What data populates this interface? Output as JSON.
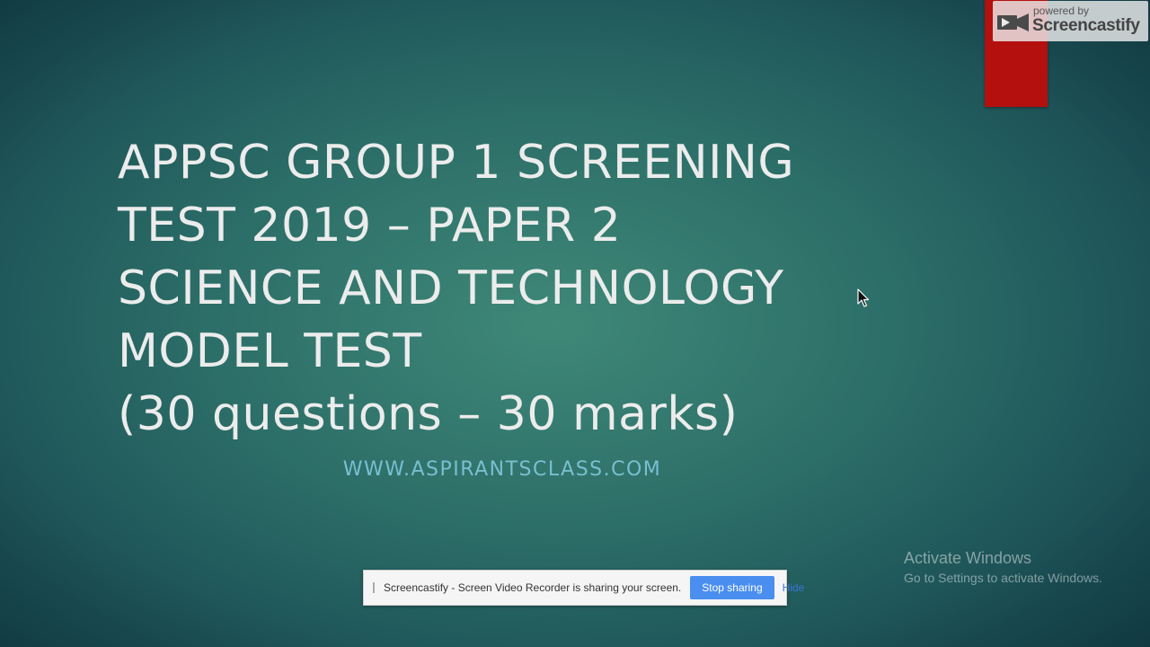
{
  "slide": {
    "title_lines": [
      "APPSC GROUP 1 SCREENING",
      "TEST 2019 – PAPER 2",
      "SCIENCE AND TECHNOLOGY",
      "MODEL TEST",
      "(30 questions – 30 marks)"
    ],
    "subtitle": "WWW.ASPIRANTSCLASS.COM"
  },
  "watermark": {
    "powered_by": "powered by",
    "brand": "Screencastify",
    "icon": "screencastify-logo-icon"
  },
  "windows_activation": {
    "title": "Activate Windows",
    "message": "Go to Settings to activate Windows."
  },
  "share_bar": {
    "message": "Screencastify - Screen Video Recorder is sharing your screen.",
    "stop_label": "Stop sharing",
    "hide_label": "Hide"
  },
  "cursor": {
    "icon": "mouse-pointer-icon"
  },
  "colors": {
    "background": "#2c6e68",
    "title_text": "#ececec",
    "subtitle_text": "#79bfd1",
    "accent_bar": "#b3100e",
    "stop_button": "#4a8ef0"
  }
}
